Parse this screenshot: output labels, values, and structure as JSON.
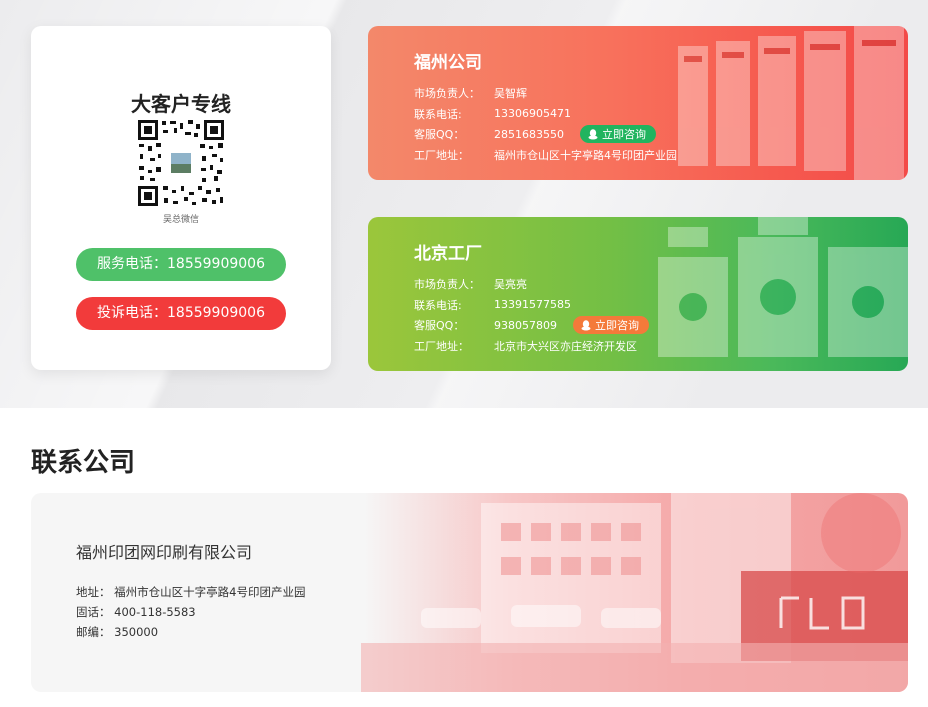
{
  "vip": {
    "title": "大客户专线",
    "qr_caption": "吴总微信",
    "service_phone": "服务电话：18559909006",
    "complaint_phone": "投诉电话：18559909006"
  },
  "companies": [
    {
      "name": "福州公司",
      "rows": [
        {
          "label": "市场负责人：",
          "value": "吴智辉"
        },
        {
          "label": "联系电话:",
          "value": "13306905471"
        },
        {
          "label": "客服QQ：",
          "value": "2851683550"
        },
        {
          "label": "工厂地址：",
          "value": "福州市仓山区十字亭路4号印团产业园"
        }
      ],
      "consult_label": "立即咨询",
      "consult_color": "#21b45f"
    },
    {
      "name": "北京工厂",
      "rows": [
        {
          "label": "市场负责人：",
          "value": "吴亮亮"
        },
        {
          "label": "联系电话:",
          "value": "13391577585"
        },
        {
          "label": "客服QQ：",
          "value": "938057809"
        },
        {
          "label": "工厂地址：",
          "value": "北京市大兴区亦庄经济开发区"
        }
      ],
      "consult_label": "立即咨询",
      "consult_color": "#f47a3a"
    }
  ],
  "contact": {
    "section_title": "联系公司",
    "company_name": "福州印团网印刷有限公司",
    "rows": [
      {
        "label": "地址：",
        "value": "福州市仓山区十字亭路4号印团产业园"
      },
      {
        "label": "固话：",
        "value": "400-118-5583"
      },
      {
        "label": "邮编：",
        "value": "350000"
      }
    ]
  },
  "colors": {
    "green_pill": "#4fc169",
    "red_pill": "#f23b3b",
    "fz_gradient_start": "#f3886a",
    "fz_gradient_end": "#f34a48",
    "bj_gradient_start": "#9bc63b",
    "bj_gradient_end": "#27a855"
  },
  "icons": {
    "consult": "qq-penguin-icon",
    "qr": "qr-code-icon"
  }
}
